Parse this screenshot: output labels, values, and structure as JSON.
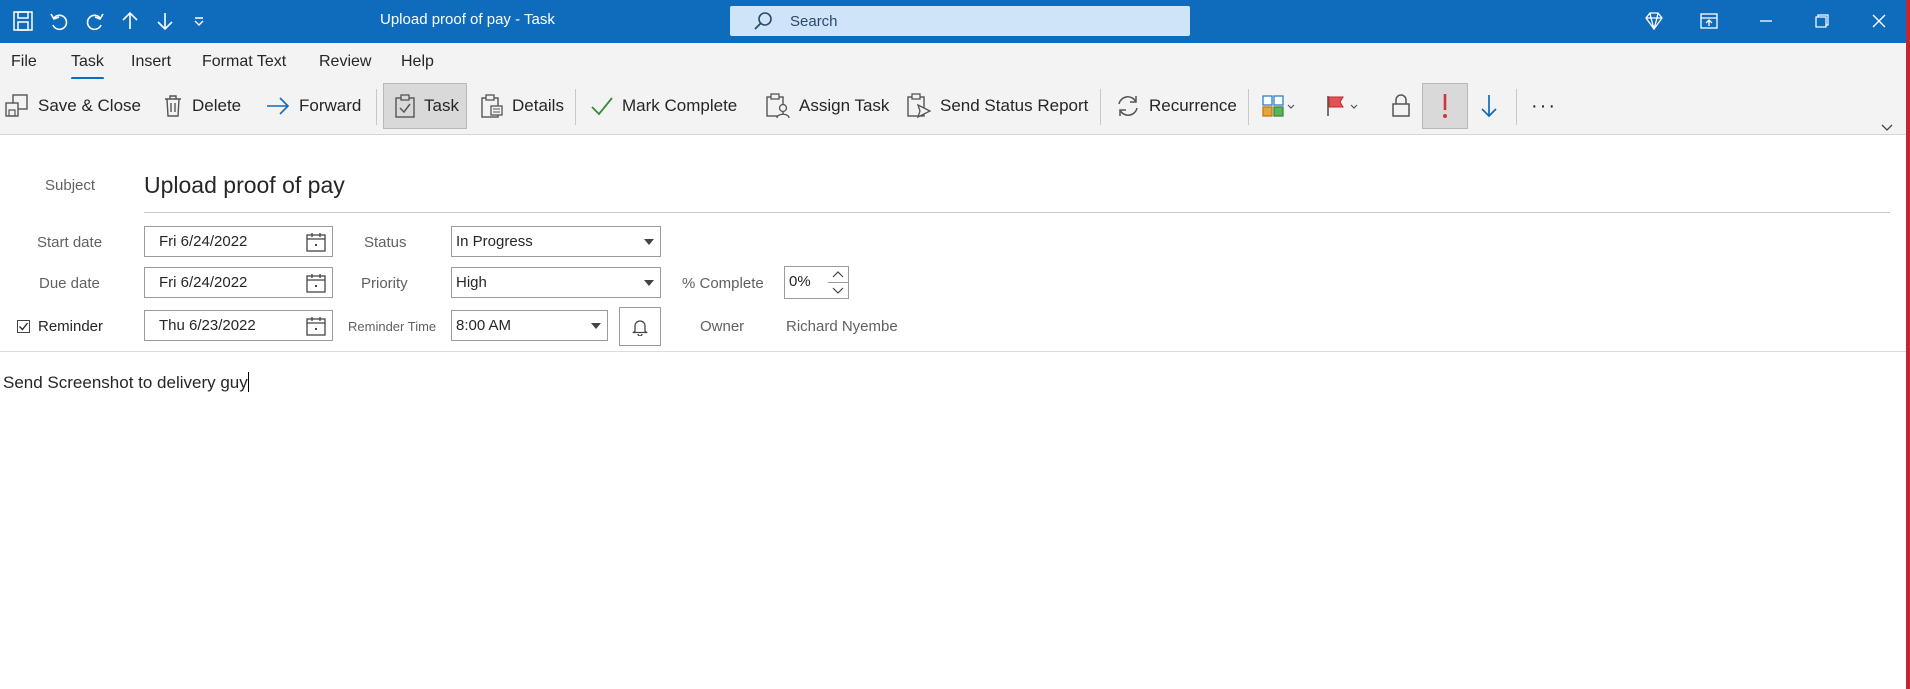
{
  "window": {
    "title": "Upload proof of pay  -  Task",
    "search_placeholder": "Search"
  },
  "menu": [
    "File",
    "Task",
    "Insert",
    "Format Text",
    "Review",
    "Help"
  ],
  "ribbon": {
    "save_close": "Save & Close",
    "delete": "Delete",
    "forward": "Forward",
    "task": "Task",
    "details": "Details",
    "mark_complete": "Mark Complete",
    "assign_task": "Assign Task",
    "send_status_report": "Send Status Report",
    "recurrence": "Recurrence",
    "more": "···"
  },
  "form": {
    "subject_label": "Subject",
    "subject": "Upload proof of pay",
    "start_date_label": "Start date",
    "start_date": "Fri 6/24/2022",
    "due_date_label": "Due date",
    "due_date": "Fri 6/24/2022",
    "reminder_label": "Reminder",
    "reminder_checked": true,
    "reminder_date": "Thu 6/23/2022",
    "status_label": "Status",
    "status": "In Progress",
    "priority_label": "Priority",
    "priority": "High",
    "reminder_time_label": "Reminder Time",
    "reminder_time": "8:00 AM",
    "percent_label": "% Complete",
    "percent": "0%",
    "owner_label": "Owner",
    "owner": "Richard Nyembe"
  },
  "body": {
    "text": "Send Screenshot to delivery guy"
  },
  "colors": {
    "titlebar": "#0f6cbd",
    "accent": "#0f6cbd",
    "high_importance": "#d13438",
    "low_importance": "#0f6cbd"
  }
}
